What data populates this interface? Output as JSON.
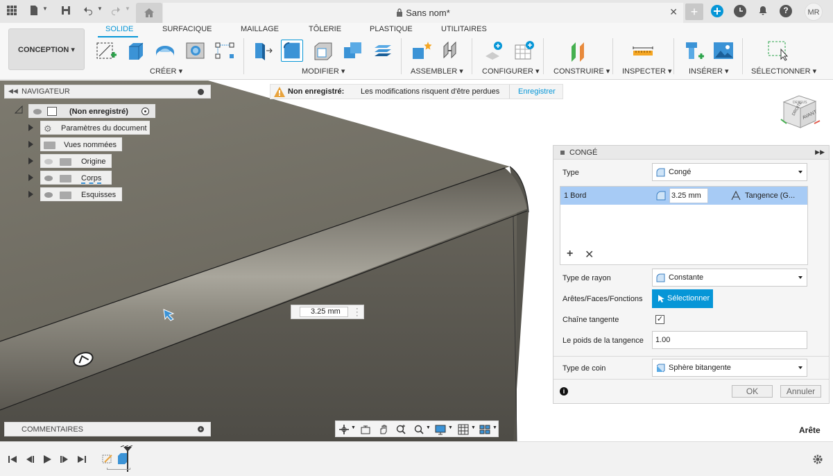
{
  "titlebar": {
    "document_title": "Sans nom*",
    "user_initials": "MR"
  },
  "ribbon": {
    "workspace": "CONCEPTION",
    "tabs": [
      "SOLIDE",
      "SURFACIQUE",
      "MAILLAGE",
      "TÔLERIE",
      "PLASTIQUE",
      "UTILITAIRES"
    ],
    "active_tab": "SOLIDE",
    "groups": [
      "CRÉER",
      "MODIFIER",
      "ASSEMBLER",
      "CONFIGURER",
      "CONSTRUIRE",
      "INSPECTER",
      "INSÉRER",
      "SÉLECTIONNER"
    ]
  },
  "navigator": {
    "title": "NAVIGATEUR",
    "root": "(Non enregistré)",
    "items": [
      "Paramètres du document",
      "Vues nommées",
      "Origine",
      "Corps",
      "Esquisses"
    ]
  },
  "warning": {
    "title": "Non enregistré:",
    "message": "Les modifications risquent d'être perdues",
    "action": "Enregistrer"
  },
  "viewcube": {
    "top": "DESSUS",
    "front": "AVANT",
    "right": "DROITE"
  },
  "viewport": {
    "dimension_value": "3.25 mm",
    "selection_label": "Arête"
  },
  "comments": {
    "title": "COMMENTAIRES"
  },
  "fillet_panel": {
    "title": "CONGÉ",
    "type_label": "Type",
    "type_value": "Congé",
    "edge_row": {
      "name": "1 Bord",
      "radius": "3.25 mm",
      "continuity": "Tangence (G..."
    },
    "radius_type_label": "Type de rayon",
    "radius_type_value": "Constante",
    "selection_label": "Arêtes/Faces/Fonctions",
    "selection_button": "Sélectionner",
    "tangent_chain_label": "Chaîne tangente",
    "tangent_chain_checked": true,
    "tangent_weight_label": "Le poids de la tangence",
    "tangent_weight_value": "1.00",
    "corner_type_label": "Type de coin",
    "corner_type_value": "Sphère bitangente",
    "ok_label": "OK",
    "cancel_label": "Annuler"
  },
  "colors": {
    "accent": "#0696d7",
    "selection_row": "#a7cbf5",
    "model_surface": "#6e6a5f",
    "warning": "#e8a33d"
  }
}
